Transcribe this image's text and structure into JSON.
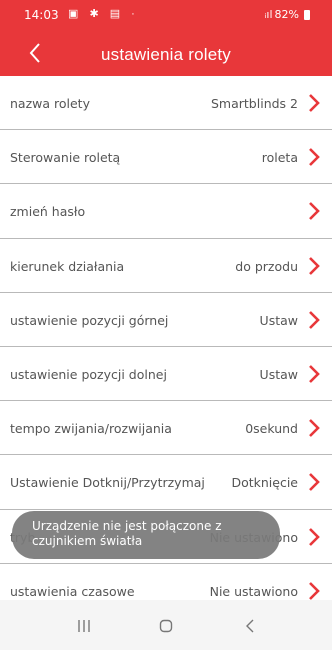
{
  "status_bar": {
    "time": "14:03",
    "battery": "82%",
    "signal_icon": "signal-icon",
    "battery_icon": "battery-icon"
  },
  "app_bar": {
    "title": "ustawienia rolety",
    "back_icon": "back-chevron-icon",
    "background": "#e8373a"
  },
  "settings": {
    "items": [
      {
        "label": "nazwa rolety",
        "value": "Smartblinds 2"
      },
      {
        "label": "Sterowanie roletą",
        "value": "roleta"
      },
      {
        "label": "zmień hasło",
        "value": ""
      },
      {
        "label": "kierunek działania",
        "value": "do przodu"
      },
      {
        "label": "ustawienie pozycji górnej",
        "value": "Ustaw"
      },
      {
        "label": "ustawienie pozycji dolnej",
        "value": "Ustaw"
      },
      {
        "label": "tempo zwijania/rozwijania",
        "value": "0sekund"
      },
      {
        "label": "Ustawienie Dotknij/Przytrzymaj",
        "value": "Dotknięcie"
      },
      {
        "label": "tryb",
        "value": "Nie ustawiono"
      },
      {
        "label": "ustawienia czasowe",
        "value": "Nie ustawiono"
      }
    ],
    "chevron_color": "#e8373a"
  },
  "toast": {
    "message": "Urządzenie nie jest połączone z czujnikiem światła"
  },
  "nav_bar": {
    "recents_icon": "recents-icon",
    "home_icon": "home-icon",
    "back_icon": "back-icon"
  }
}
